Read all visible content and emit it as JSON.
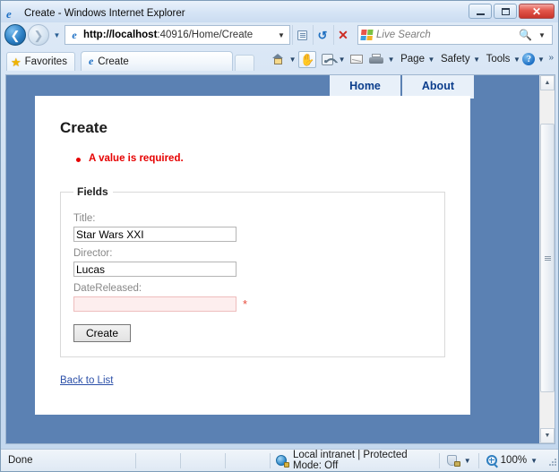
{
  "window": {
    "title": "Create - Windows Internet Explorer",
    "minimize_label": "Minimize",
    "maximize_label": "Maximize",
    "close_label": "Close"
  },
  "address_bar": {
    "url_protocol_host": "http://localhost",
    "url_rest": ":40916/Home/Create",
    "url_full": "http://localhost:40916/Home/Create",
    "back_label": "Back",
    "forward_label": "Forward",
    "history_label": "Recent Pages",
    "compatibility_label": "Compatibility View",
    "refresh_label": "Refresh",
    "stop_label": "Stop",
    "search_placeholder": "Live Search",
    "search_value": ""
  },
  "favorites": {
    "label": "Favorites",
    "icon": "star-icon"
  },
  "tabs": [
    {
      "label": "Create",
      "icon": "ie-icon"
    }
  ],
  "new_tab_label": "New Tab",
  "command_bar": {
    "items": [
      {
        "name": "home",
        "icon": "home-icon",
        "label": ""
      },
      {
        "name": "read-mail",
        "icon": "hand-icon",
        "label": ""
      },
      {
        "name": "feeds",
        "icon": "rss-icon",
        "label": ""
      },
      {
        "name": "mail",
        "icon": "mail-icon",
        "label": ""
      },
      {
        "name": "print",
        "icon": "printer-icon",
        "label": ""
      }
    ],
    "page_label": "Page",
    "safety_label": "Safety",
    "tools_label": "Tools",
    "help_label": "?",
    "overflow_label": "»"
  },
  "site_nav": {
    "items": [
      {
        "label": "Home"
      },
      {
        "label": "About"
      }
    ]
  },
  "page": {
    "heading": "Create",
    "validation_summary": [
      "A value is required."
    ],
    "fieldset_legend": "Fields",
    "fields": [
      {
        "label": "Title:",
        "value": "Star Wars XXI",
        "placeholder": "",
        "error": false,
        "required_marker": ""
      },
      {
        "label": "Director:",
        "value": "Lucas",
        "placeholder": "",
        "error": false,
        "required_marker": ""
      },
      {
        "label": "DateReleased:",
        "value": "",
        "placeholder": "",
        "error": true,
        "required_marker": "*"
      }
    ],
    "submit_label": "Create",
    "back_link_label": "Back to List"
  },
  "status_bar": {
    "status_text": "Done",
    "zone_text": "Local intranet | Protected Mode: Off",
    "zoom_text": "100%"
  },
  "colors": {
    "page_background_blue": "#5b81b3",
    "content_white": "#ffffff",
    "error_red": "#e60000",
    "error_field_bg": "#fdeeee",
    "nav_link_blue": "#0b3d8c",
    "link_blue": "#2b4fa8"
  }
}
